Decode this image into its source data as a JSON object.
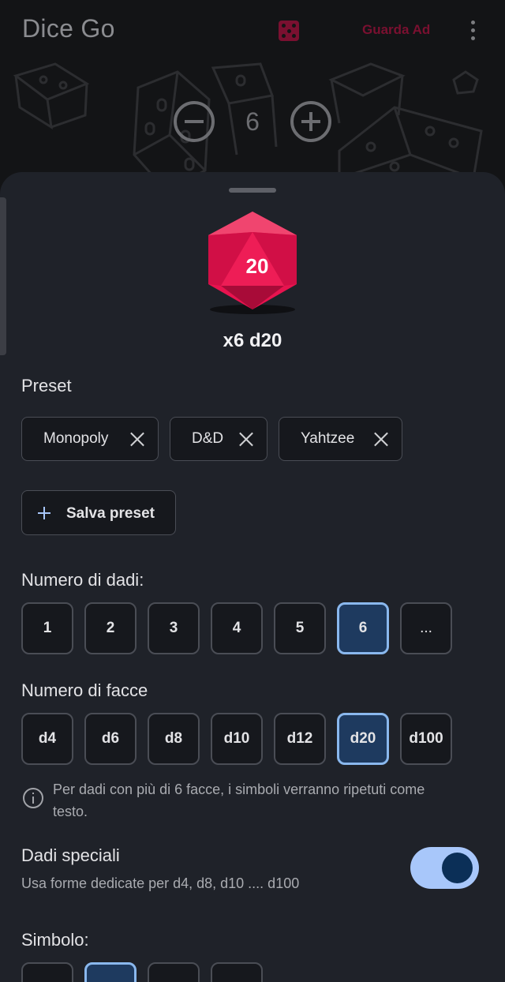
{
  "appbar": {
    "title": "Dice Go",
    "dice_icon": "dice-five-icon",
    "ad_label": "Guarda Ad",
    "more_icon": "more-vert-icon"
  },
  "stepper": {
    "count": "6",
    "minus_icon": "minus-circle-icon",
    "plus_icon": "plus-circle-icon"
  },
  "sheet": {
    "die_value": "20",
    "die_icon": "d20-icon",
    "die_summary": "x6 d20",
    "preset_label": "Preset",
    "presets": [
      {
        "label": "Monopoly"
      },
      {
        "label": "D&D"
      },
      {
        "label": "Yahtzee"
      }
    ],
    "save_preset_label": "Salva preset",
    "num_dice_label": "Numero di dadi:",
    "num_dice_options": [
      "1",
      "2",
      "3",
      "4",
      "5",
      "6",
      "..."
    ],
    "num_dice_selected": "6",
    "num_faces_label": "Numero di facce",
    "num_faces_options": [
      "d4",
      "d6",
      "d8",
      "d10",
      "d12",
      "d20",
      "d100"
    ],
    "num_faces_selected": "d20",
    "info_text": "Per dadi con più di 6 facce, i simboli verranno ripetuti come testo.",
    "special_title": "Dadi speciali",
    "special_desc": "Usa forme dedicate per d4, d8, d10 .... d100",
    "special_enabled": true,
    "symbol_label": "Simbolo:"
  },
  "colors": {
    "accent": "#e8134f",
    "selected_bg": "#1e3a5f",
    "selected_border": "#8ab8ee",
    "toggle_track": "#a8c7fa",
    "sheet_bg": "#1f2229"
  }
}
